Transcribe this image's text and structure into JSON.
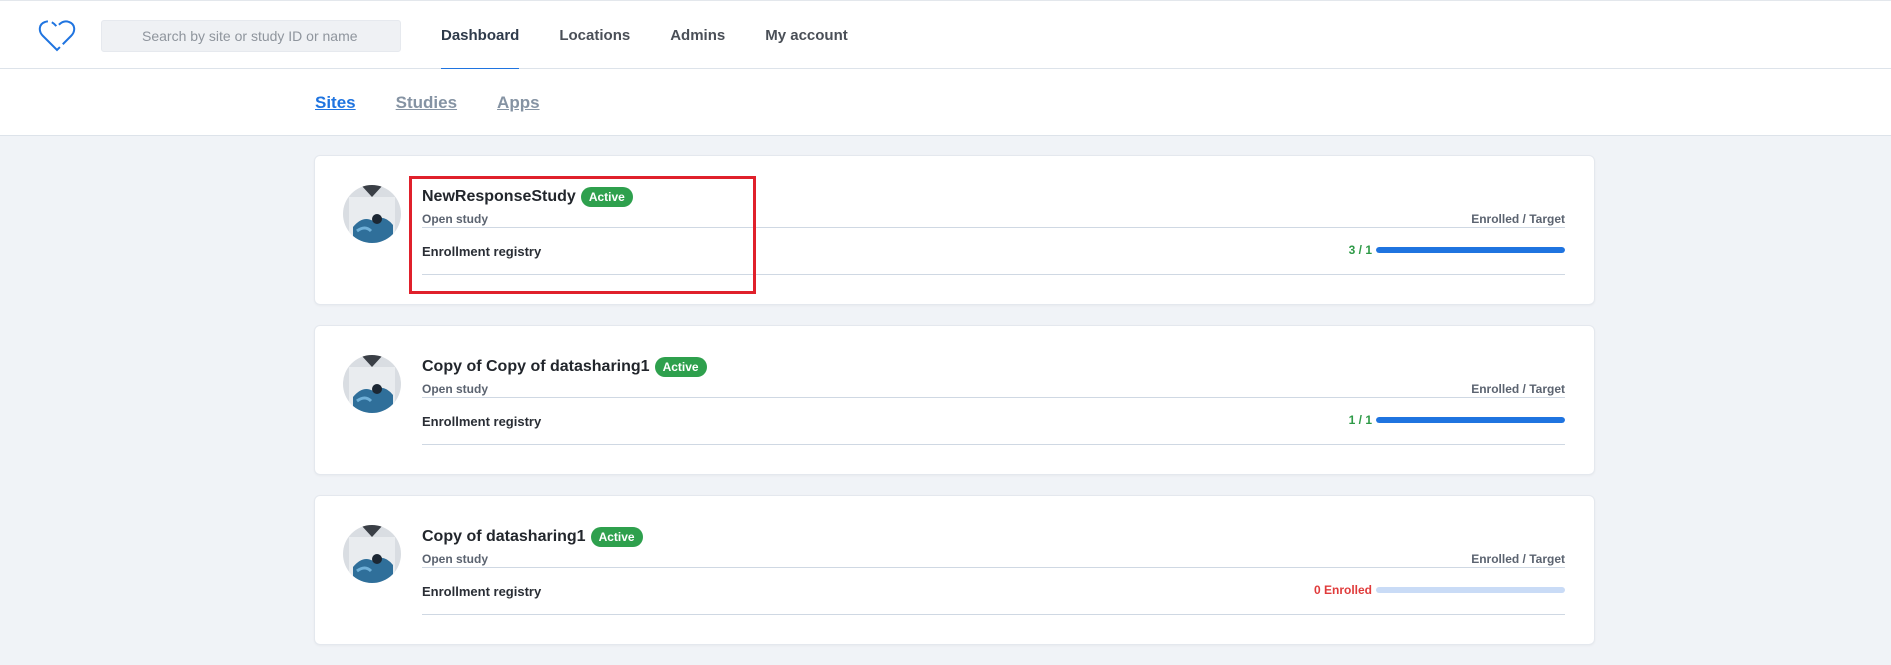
{
  "header": {
    "search_placeholder": "Search by site or study ID or name",
    "nav": [
      {
        "label": "Dashboard",
        "active": true
      },
      {
        "label": "Locations",
        "active": false
      },
      {
        "label": "Admins",
        "active": false
      },
      {
        "label": "My account",
        "active": false
      }
    ]
  },
  "subtabs": [
    {
      "label": "Sites",
      "active": true
    },
    {
      "label": "Studies",
      "active": false
    },
    {
      "label": "Apps",
      "active": false
    }
  ],
  "cards": [
    {
      "title": "NewResponseStudy",
      "status": "Active",
      "subtitle": "Open study",
      "column_label": "Enrolled / Target",
      "registry": "Enrollment registry",
      "count": "3 / 1",
      "progress": 1.0
    },
    {
      "title": "Copy of Copy of datasharing1",
      "status": "Active",
      "subtitle": "Open study",
      "column_label": "Enrolled / Target",
      "registry": "Enrollment registry",
      "count": "1 / 1",
      "progress": 1.0
    },
    {
      "title": "Copy of datasharing1",
      "status": "Active",
      "subtitle": "Open study",
      "column_label": "Enrolled / Target",
      "registry": "Enrollment registry",
      "count": "0 Enrolled",
      "progress": 0.0
    }
  ],
  "colors": {
    "accent": "#1f74e0",
    "active_badge": "#2ea04d",
    "zero_count": "#e03b3b",
    "highlight": "#e0202b"
  }
}
